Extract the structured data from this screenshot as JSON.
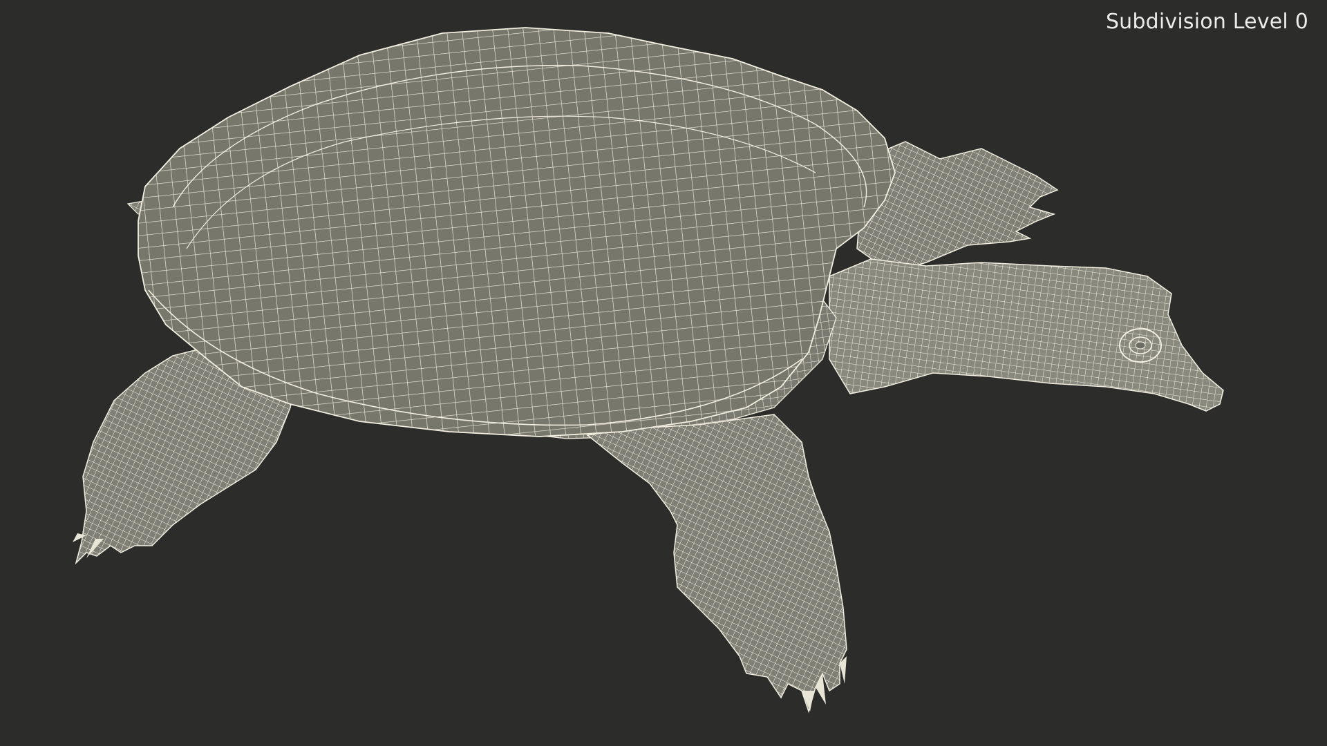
{
  "viewport": {
    "subdivision_label": "Subdivision Level 0",
    "background_color": "#2c2c2a"
  },
  "model": {
    "subject": "soft-shell turtle wireframe",
    "surface_color": "#7a796f",
    "wire_color": "#f2efe0"
  }
}
